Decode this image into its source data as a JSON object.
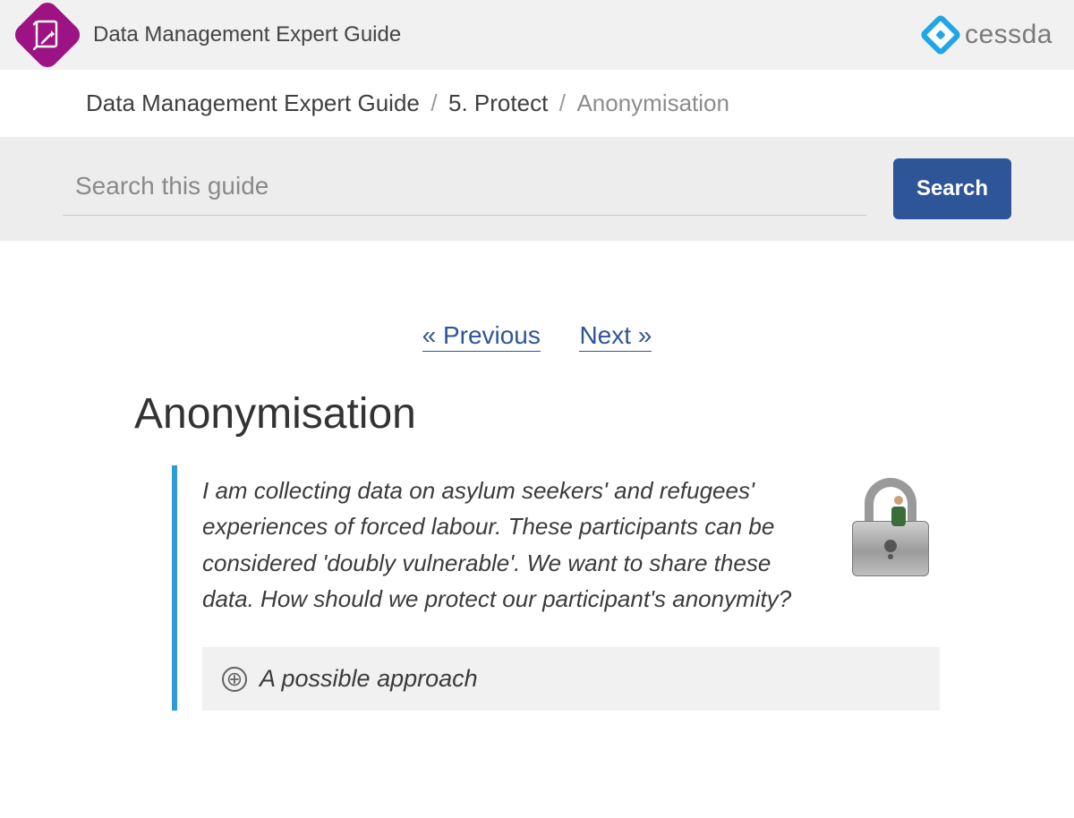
{
  "header": {
    "site_title": "Data Management Expert Guide",
    "brand_name": "cessda"
  },
  "breadcrumb": {
    "items": [
      {
        "label": "Data Management Expert Guide"
      },
      {
        "label": "5. Protect"
      }
    ],
    "current": "Anonymisation",
    "separator": "/"
  },
  "search": {
    "placeholder": "Search this guide",
    "button_label": "Search"
  },
  "pager": {
    "prev_label": "« Previous",
    "next_label": "Next »"
  },
  "page": {
    "title": "Anonymisation",
    "quote": "I am collecting data on asylum seekers' and refugees' experiences of forced labour. These participants can be considered 'doubly vulnerable'. We want to share these data. How should we protect our participant's anonymity?",
    "approach_label": "A possible approach"
  },
  "icons": {
    "expand": "⊕"
  }
}
